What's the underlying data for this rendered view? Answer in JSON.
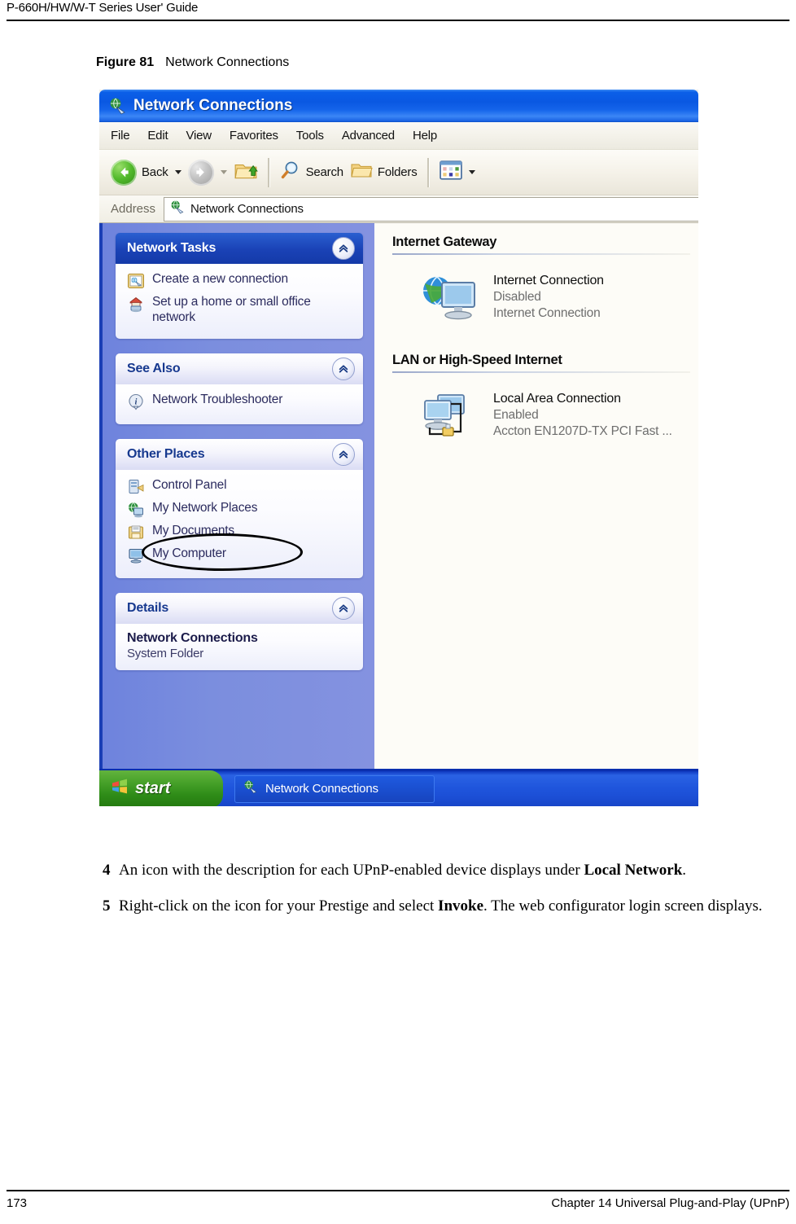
{
  "page": {
    "running_header": "P-660H/HW/W-T Series User' Guide",
    "footer_page_number": "173",
    "footer_chapter": "Chapter 14 Universal Plug-and-Play (UPnP)"
  },
  "figure": {
    "label": "Figure 81",
    "title": "Network Connections"
  },
  "window": {
    "title": "Network Connections",
    "title_icon": "network-connections-icon",
    "menu": [
      {
        "label": "File"
      },
      {
        "label": "Edit"
      },
      {
        "label": "View"
      },
      {
        "label": "Favorites"
      },
      {
        "label": "Tools"
      },
      {
        "label": "Advanced"
      },
      {
        "label": "Help"
      }
    ],
    "toolbar": {
      "back_label": "Back",
      "back_icon": "back-arrow-icon",
      "forward_icon": "forward-arrow-icon",
      "up_icon": "up-folder-icon",
      "search_label": "Search",
      "search_icon": "magnifier-icon",
      "folders_label": "Folders",
      "folders_icon": "folder-icon",
      "views_icon": "views-icon"
    },
    "address": {
      "label": "Address",
      "value": "Network Connections",
      "icon": "network-connections-icon"
    }
  },
  "taskpane": {
    "panels": [
      {
        "title": "Network Tasks",
        "style": "dark",
        "collapse_icon": "chevron-up-icon",
        "items": [
          {
            "label": "Create a new connection",
            "icon": "new-connection-icon"
          },
          {
            "label": "Set up a home or small office network",
            "icon": "home-network-icon"
          }
        ]
      },
      {
        "title": "See Also",
        "style": "light",
        "collapse_icon": "chevron-up-icon",
        "items": [
          {
            "label": "Network Troubleshooter",
            "icon": "info-icon"
          }
        ]
      },
      {
        "title": "Other Places",
        "style": "light",
        "collapse_icon": "chevron-up-icon",
        "items": [
          {
            "label": "Control Panel",
            "icon": "control-panel-icon"
          },
          {
            "label": "My Network Places",
            "icon": "my-network-places-icon",
            "annotated": true
          },
          {
            "label": "My Documents",
            "icon": "my-documents-icon"
          },
          {
            "label": "My Computer",
            "icon": "my-computer-icon"
          }
        ]
      },
      {
        "title": "Details",
        "style": "light",
        "collapse_icon": "chevron-up-icon",
        "details_title": "Network Connections",
        "details_subtitle": "System Folder"
      }
    ]
  },
  "content": {
    "groups": [
      {
        "heading": "Internet Gateway",
        "items": [
          {
            "name": "Internet Connection",
            "state": "Disabled",
            "device": "Internet Connection",
            "icon": "internet-gateway-icon"
          }
        ]
      },
      {
        "heading": "LAN or High-Speed Internet",
        "items": [
          {
            "name": "Local Area Connection",
            "state": "Enabled",
            "device": "Accton EN1207D-TX PCI Fast ...",
            "icon": "lan-connection-icon"
          }
        ]
      }
    ]
  },
  "taskbar": {
    "start_label": "start",
    "start_icon": "windows-flag-icon",
    "buttons": [
      {
        "label": "Network Connections",
        "icon": "network-connections-icon"
      }
    ]
  },
  "steps": [
    {
      "number": "4",
      "parts": [
        {
          "t": "An icon with the description for each UPnP-enabled device displays under ",
          "b": false
        },
        {
          "t": "Local Network",
          "b": true
        },
        {
          "t": ".",
          "b": false
        }
      ]
    },
    {
      "number": "5",
      "parts": [
        {
          "t": "Right-click on the icon for your Prestige and select ",
          "b": false
        },
        {
          "t": "Invoke",
          "b": true
        },
        {
          "t": ". The web configurator login screen displays.",
          "b": false
        }
      ]
    }
  ],
  "colors": {
    "titlebar_blue": "#0a58e2",
    "taskpane_blue": "#7b8ede",
    "panel_header_dark": "#1a42b6",
    "panel_header_text_dark": "#17398f",
    "taskbar_blue": "#1f55dc",
    "start_green": "#2f8c18",
    "content_bg": "#fdfcf7"
  }
}
